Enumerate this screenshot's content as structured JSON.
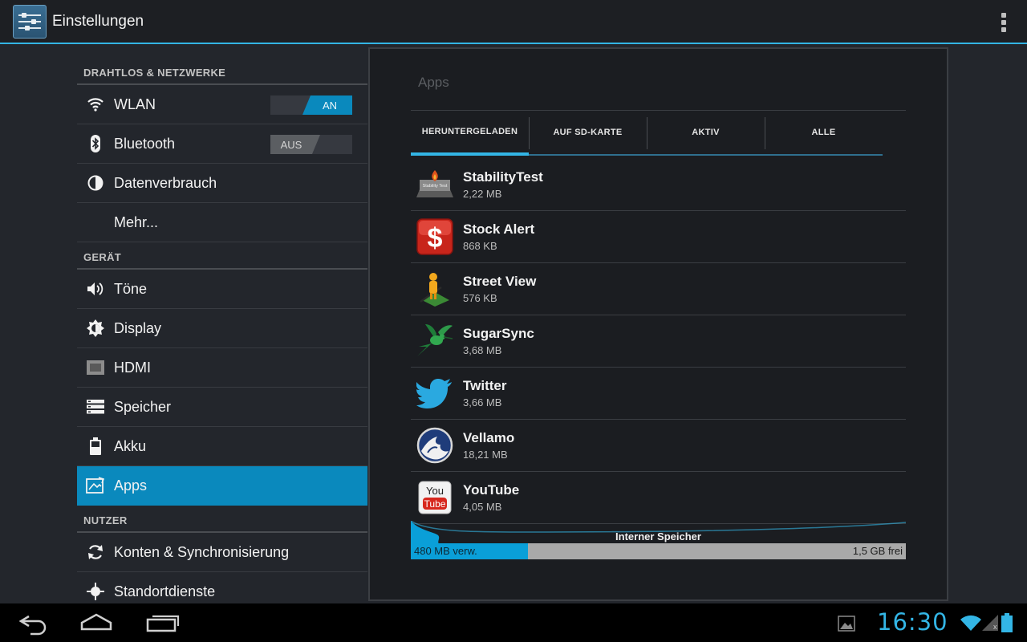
{
  "actionbar": {
    "title": "Einstellungen",
    "app_icon": "settings-sliders-icon",
    "overflow_icon": "overflow-menu-icon"
  },
  "sidebar": {
    "sections": [
      {
        "header": "DRAHTLOS & NETZWERKE",
        "items": [
          {
            "label": "WLAN",
            "icon": "wifi-icon",
            "toggle": "AN",
            "toggle_state": "on"
          },
          {
            "label": "Bluetooth",
            "icon": "bluetooth-icon",
            "toggle": "AUS",
            "toggle_state": "off"
          },
          {
            "label": "Datenverbrauch",
            "icon": "data-usage-icon"
          },
          {
            "label": "Mehr...",
            "icon": ""
          }
        ]
      },
      {
        "header": "GERÄT",
        "items": [
          {
            "label": "Töne",
            "icon": "speaker-icon"
          },
          {
            "label": "Display",
            "icon": "brightness-icon"
          },
          {
            "label": "HDMI",
            "icon": "hdmi-icon"
          },
          {
            "label": "Speicher",
            "icon": "storage-icon"
          },
          {
            "label": "Akku",
            "icon": "battery-icon"
          },
          {
            "label": "Apps",
            "icon": "apps-icon",
            "selected": true
          }
        ]
      },
      {
        "header": "NUTZER",
        "items": [
          {
            "label": "Konten & Synchronisierung",
            "icon": "sync-icon"
          },
          {
            "label": "Standortdienste",
            "icon": "location-icon"
          }
        ]
      }
    ]
  },
  "main": {
    "title": "Apps",
    "tabs": [
      {
        "label": "HERUNTERGELADEN",
        "active": true
      },
      {
        "label": "AUF SD-KARTE"
      },
      {
        "label": "AKTIV"
      },
      {
        "label": "ALLE"
      }
    ],
    "apps": [
      {
        "name": "StabilityTest",
        "size": "2,22 MB",
        "icon": "stabilitytest-icon",
        "icon_text": "Stability Test"
      },
      {
        "name": "Stock Alert",
        "size": "868 KB",
        "icon": "stock-alert-icon",
        "icon_text": "$"
      },
      {
        "name": "Street View",
        "size": "576 KB",
        "icon": "street-view-icon"
      },
      {
        "name": "SugarSync",
        "size": "3,68 MB",
        "icon": "sugarsync-hummingbird-icon"
      },
      {
        "name": "Twitter",
        "size": "3,66 MB",
        "icon": "twitter-bird-icon"
      },
      {
        "name": "Vellamo",
        "size": "18,21 MB",
        "icon": "vellamo-icon"
      },
      {
        "name": "YouTube",
        "size": "4,05 MB",
        "icon": "youtube-icon",
        "icon_text_top": "You",
        "icon_text_bottom": "Tube"
      }
    ],
    "storage": {
      "label": "Interner Speicher",
      "used": "480 MB verw.",
      "free": "1,5 GB frei",
      "used_fraction": 0.237
    }
  },
  "navbar": {
    "clock": "16:30",
    "icons": [
      "back-icon",
      "home-icon",
      "recent-apps-icon",
      "gallery-notification-icon",
      "wifi-status-icon",
      "signal-status-icon",
      "battery-status-icon"
    ]
  },
  "colors": {
    "accent": "#33b5e5",
    "selected": "#0a89bd",
    "storage_used": "#0a9fd8"
  }
}
